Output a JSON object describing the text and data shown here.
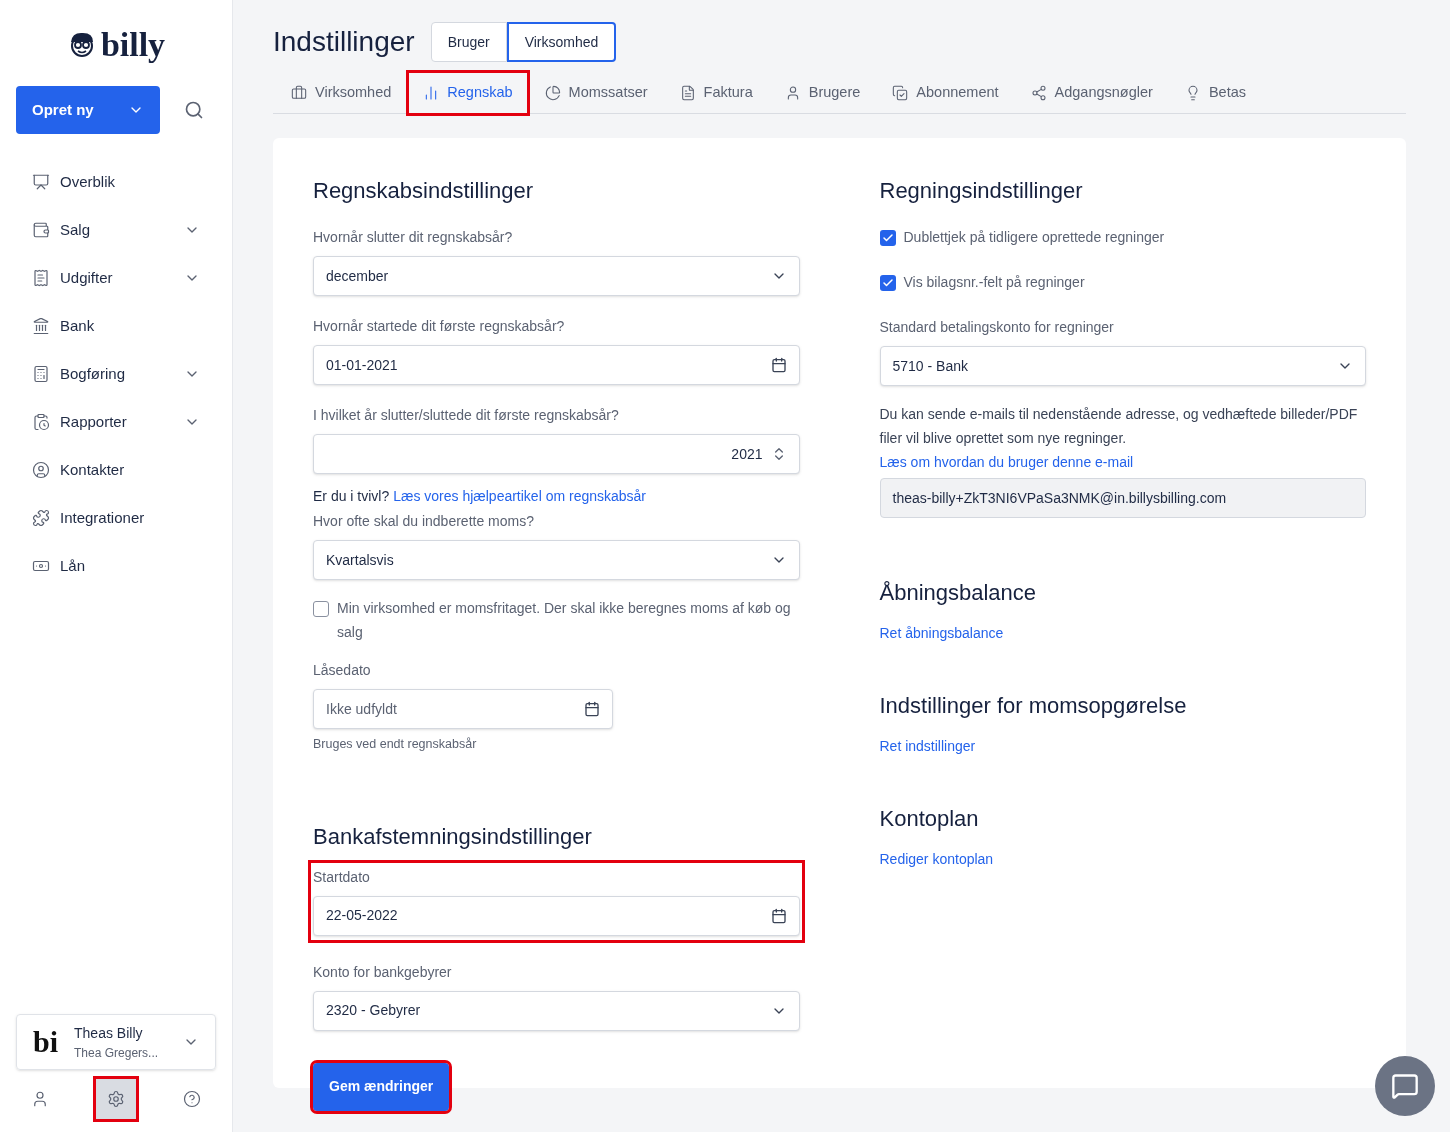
{
  "sidebar": {
    "logo": "billy",
    "create_button": "Opret ny",
    "items": [
      {
        "label": "Overblik",
        "expandable": false
      },
      {
        "label": "Salg",
        "expandable": true
      },
      {
        "label": "Udgifter",
        "expandable": true
      },
      {
        "label": "Bank",
        "expandable": false
      },
      {
        "label": "Bogføring",
        "expandable": true
      },
      {
        "label": "Rapporter",
        "expandable": true
      },
      {
        "label": "Kontakter",
        "expandable": false
      },
      {
        "label": "Integrationer",
        "expandable": false
      },
      {
        "label": "Lån",
        "expandable": false
      }
    ],
    "org": {
      "logo_text": "bi",
      "name": "Theas Billy",
      "user": "Thea Gregers..."
    },
    "bottom_icons": [
      {
        "selected": false,
        "highlighted": false
      },
      {
        "selected": true,
        "highlighted": true
      },
      {
        "selected": false,
        "highlighted": false
      }
    ]
  },
  "page": {
    "title": "Indstillinger",
    "scope_toggle": [
      {
        "label": "Bruger",
        "selected": false
      },
      {
        "label": "Virksomhed",
        "selected": true
      }
    ],
    "tabs": [
      {
        "label": "Virksomhed",
        "selected": false,
        "highlighted": false
      },
      {
        "label": "Regnskab",
        "selected": true,
        "highlighted": true
      },
      {
        "label": "Momssatser",
        "selected": false,
        "highlighted": false
      },
      {
        "label": "Faktura",
        "selected": false,
        "highlighted": false
      },
      {
        "label": "Brugere",
        "selected": false,
        "highlighted": false
      },
      {
        "label": "Abonnement",
        "selected": false,
        "highlighted": false
      },
      {
        "label": "Adgangsnøgler",
        "selected": false,
        "highlighted": false
      },
      {
        "label": "Betas",
        "selected": false,
        "highlighted": false
      }
    ]
  },
  "accounting": {
    "title": "Regnskabsindstillinger",
    "fields": [
      {
        "kind": "select",
        "label": "Hvornår slutter dit regnskabsår?",
        "value": "december"
      },
      {
        "kind": "date",
        "label": "Hvornår startede dit første regnskabsår?",
        "value": "01-01-2021"
      },
      {
        "kind": "number",
        "label": "I hvilket år slutter/sluttede dit første regnskabsår?",
        "value": "2021"
      }
    ],
    "help": {
      "text": "Er du i tvivl?",
      "link": "Læs vores hjælpeartikel om regnskabsår"
    },
    "vat_frequency": {
      "label": "Hvor ofte skal du indberette moms?",
      "value": "Kvartalsvis"
    },
    "vat_exempt": {
      "label": "Min virksomhed er momsfritaget. Der skal ikke beregnes moms af køb og salg",
      "checked": false
    },
    "lock_date": {
      "label": "Låsedato",
      "placeholder": "Ikke udfyldt",
      "hint": "Bruges ved endt regnskabsår"
    }
  },
  "bank_reconciliation": {
    "title": "Bankafstemningsindstillinger",
    "start_date": {
      "label": "Startdato",
      "value": "22-05-2022",
      "highlighted": true
    },
    "fee_account": {
      "label": "Konto for bankgebyrer",
      "value": "2320 - Gebyrer"
    }
  },
  "save_button": {
    "label": "Gem ændringer",
    "highlighted": true
  },
  "bills": {
    "title": "Regningsindstillinger",
    "checkboxes": [
      {
        "label": "Dublettjek på tidligere oprettede regninger",
        "checked": true
      },
      {
        "label": "Vis bilagsnr.-felt på regninger",
        "checked": true
      }
    ],
    "payment_account": {
      "label": "Standard betalingskonto for regninger",
      "value": "5710 - Bank"
    },
    "email_info": {
      "text": "Du kan sende e-mails til nedenstående adresse, og vedhæftede billeder/PDF filer vil blive oprettet som nye regninger.",
      "link": "Læs om hvordan du bruger denne e-mail"
    },
    "email": "theas-billy+ZkT3NI6VPaSa3NMK@in.billysbilling.com"
  },
  "links_sections": [
    {
      "title": "Åbningsbalance",
      "link": "Ret åbningsbalance"
    },
    {
      "title": "Indstillinger for momsopgørelse",
      "link": "Ret indstillinger"
    },
    {
      "title": "Kontoplan",
      "link": "Rediger kontoplan"
    }
  ]
}
